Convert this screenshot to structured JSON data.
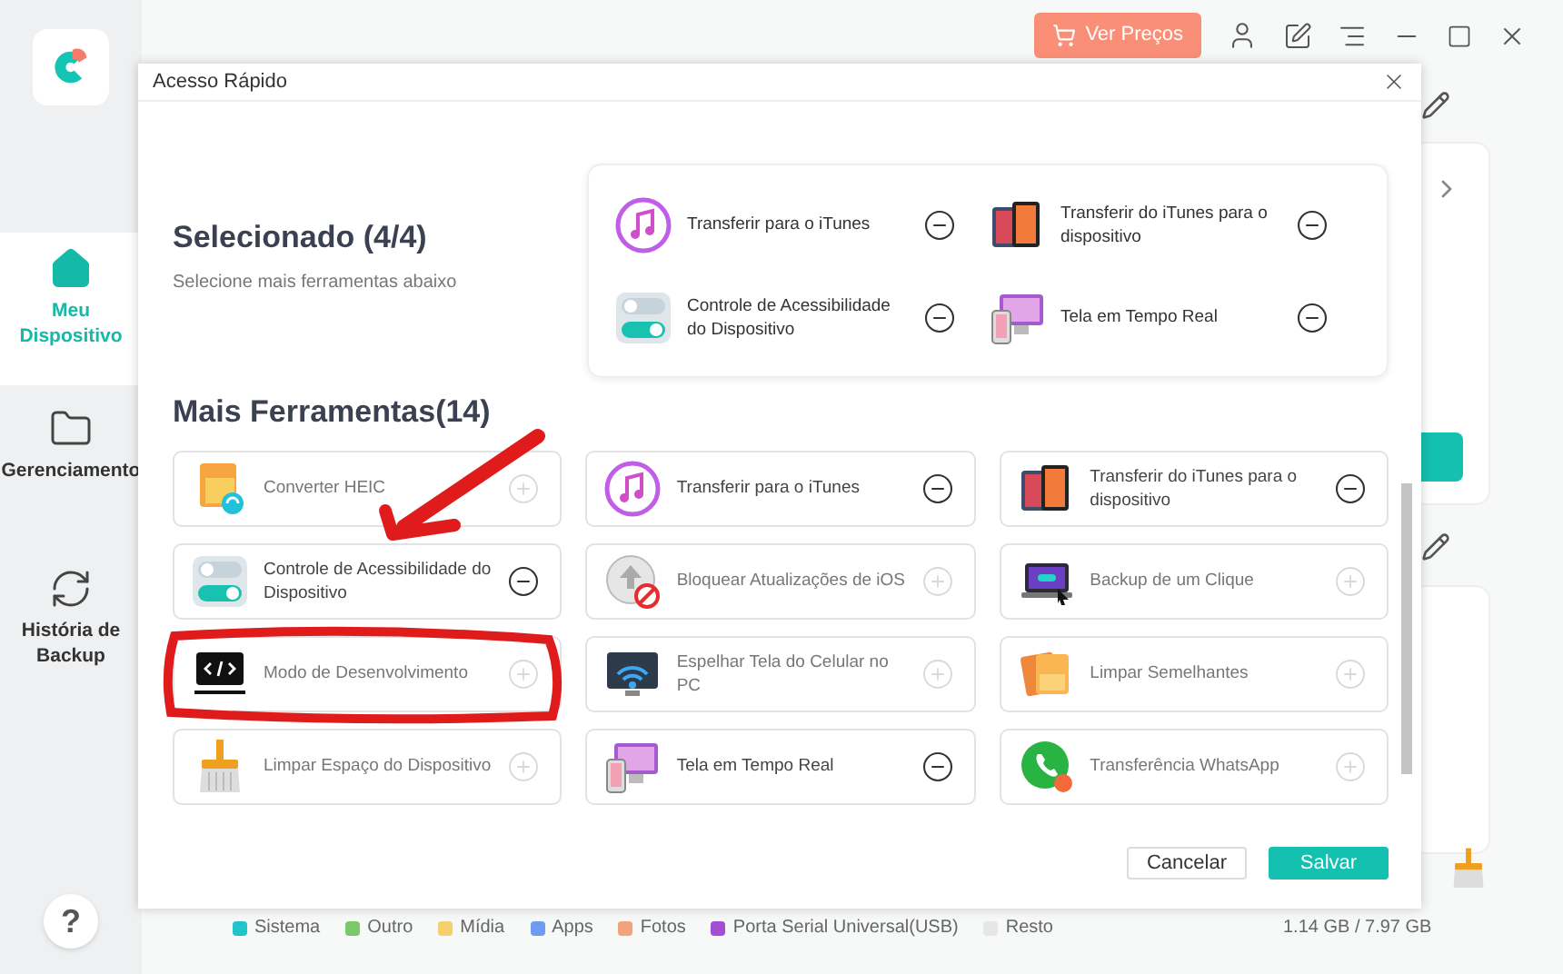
{
  "topbar": {
    "pricing_button": "Ver Preços"
  },
  "sidebar": {
    "items": [
      {
        "label": "Meu Dispositivo",
        "selected": true
      },
      {
        "label": "Gerenciamento",
        "selected": false
      },
      {
        "label": "História de Backup",
        "selected": false
      }
    ],
    "help": "?"
  },
  "legend": [
    {
      "label": "Sistema",
      "color": "#22c3c9"
    },
    {
      "label": "Outro",
      "color": "#7cc96a"
    },
    {
      "label": "Mídia",
      "color": "#f5cf6b"
    },
    {
      "label": "Apps",
      "color": "#6f9cf0"
    },
    {
      "label": "Fotos",
      "color": "#f4a27a"
    },
    {
      "label": "Porta Serial Universal(USB)",
      "color": "#a24fd6"
    },
    {
      "label": "Resto",
      "color": "#e6e6e6"
    }
  ],
  "storage": "1.14 GB / 7.97 GB",
  "dialog": {
    "title": "Acesso Rápido",
    "selected_heading": "Selecionado (4/4)",
    "selected_hint": "Selecione mais ferramentas abaixo",
    "selected_tools": [
      {
        "label": "Transferir para o iTunes"
      },
      {
        "label": "Transferir do iTunes para o dispositivo"
      },
      {
        "label": "Controle de Acessibilidade do Dispositivo"
      },
      {
        "label": "Tela em Tempo Real"
      }
    ],
    "more_heading": "Mais Ferramentas(14)",
    "tools": [
      {
        "label": "Converter HEIC",
        "selected": false
      },
      {
        "label": "Transferir para o iTunes",
        "selected": true
      },
      {
        "label": "Transferir do iTunes para o dispositivo",
        "selected": true
      },
      {
        "label": "Controle de Acessibilidade do Dispositivo",
        "selected": true
      },
      {
        "label": "Bloquear Atualizações de iOS",
        "selected": false
      },
      {
        "label": "Backup de um Clique",
        "selected": false
      },
      {
        "label": "Modo de Desenvolvimento",
        "selected": false
      },
      {
        "label": "Espelhar Tela do Celular no PC",
        "selected": false
      },
      {
        "label": "Limpar Semelhantes",
        "selected": false
      },
      {
        "label": "Limpar Espaço do Dispositivo",
        "selected": false
      },
      {
        "label": "Tela em Tempo Real",
        "selected": true
      },
      {
        "label": "Transferência WhatsApp",
        "selected": false
      }
    ],
    "buttons": [
      {
        "label": "Cancelar",
        "kind": "secondary"
      },
      {
        "label": "Salvar",
        "kind": "primary"
      }
    ]
  }
}
